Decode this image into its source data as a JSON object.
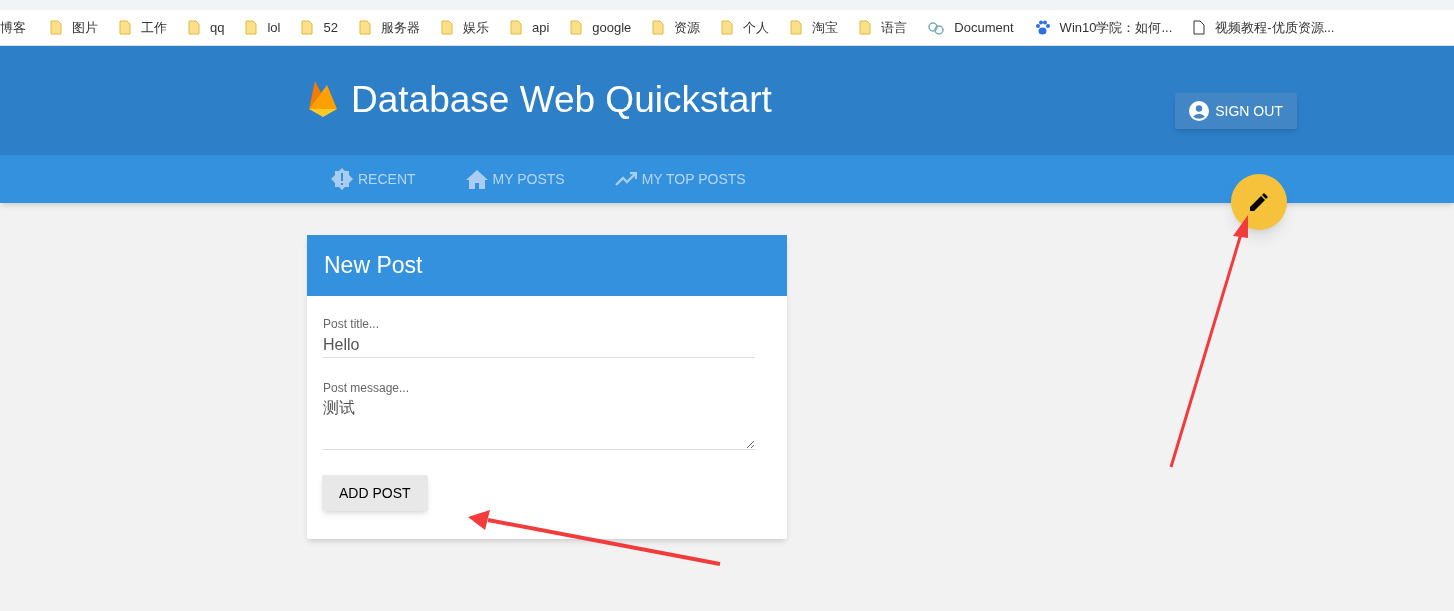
{
  "bookmarks": [
    {
      "label": "博客",
      "kind": "none"
    },
    {
      "label": "图片",
      "kind": "folder"
    },
    {
      "label": "工作",
      "kind": "folder"
    },
    {
      "label": "qq",
      "kind": "folder"
    },
    {
      "label": "lol",
      "kind": "folder"
    },
    {
      "label": "52",
      "kind": "folder"
    },
    {
      "label": "服务器",
      "kind": "folder"
    },
    {
      "label": "娱乐",
      "kind": "folder"
    },
    {
      "label": "api",
      "kind": "folder"
    },
    {
      "label": "google",
      "kind": "folder"
    },
    {
      "label": "资源",
      "kind": "folder"
    },
    {
      "label": "个人",
      "kind": "folder"
    },
    {
      "label": "淘宝",
      "kind": "folder"
    },
    {
      "label": "语言",
      "kind": "folder"
    },
    {
      "label": "Document",
      "kind": "site"
    },
    {
      "label": "Win10学院：如何...",
      "kind": "paw"
    },
    {
      "label": "视频教程-优质资源...",
      "kind": "page"
    }
  ],
  "header": {
    "title": "Database Web Quickstart",
    "sign_out": "SIGN OUT"
  },
  "tabs": [
    {
      "label": "RECENT",
      "kind": "badge"
    },
    {
      "label": "MY POSTS",
      "kind": "home"
    },
    {
      "label": "MY TOP POSTS",
      "kind": "trending"
    }
  ],
  "card": {
    "title": "New Post",
    "fields": [
      {
        "kind": "input",
        "label": "Post title...",
        "value": "Hello"
      },
      {
        "kind": "textarea",
        "label": "Post message...",
        "value": "测试"
      }
    ],
    "button": "ADD POST"
  }
}
